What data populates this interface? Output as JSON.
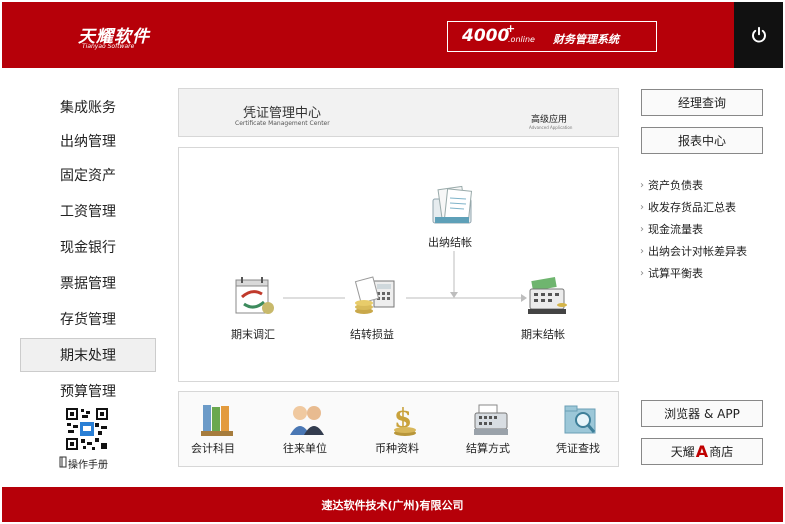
{
  "header": {
    "logo_main": "天耀软件",
    "logo_sub": "Tianyao Software",
    "system_number": "4000",
    "system_plus": "+",
    "system_online": ".online",
    "system_title": "财务管理系统",
    "power_icon": "power-icon"
  },
  "sidebar": {
    "items": [
      {
        "label": "集成账务"
      },
      {
        "label": "出纳管理"
      },
      {
        "label": "固定资产"
      },
      {
        "label": "工资管理"
      },
      {
        "label": "现金银行"
      },
      {
        "label": "票据管理"
      },
      {
        "label": "存货管理"
      },
      {
        "label": "期末处理",
        "active": true
      },
      {
        "label": "预算管理"
      }
    ],
    "qr_icon": "qr-code-icon",
    "manual_label": "操作手册"
  },
  "certificate": {
    "title": "凭证管理中心",
    "subtitle": "Certificate Management Center",
    "advanced": "高级应用",
    "advanced_sub": "Advanced Application"
  },
  "flow": {
    "cashier_close": "出纳结帐",
    "period_adjust": "期末调汇",
    "transfer_pl": "结转损益",
    "period_close": "期末结帐"
  },
  "toolbar": {
    "items": [
      {
        "label": "会计科目",
        "icon": "binders-icon"
      },
      {
        "label": "往来单位",
        "icon": "people-icon"
      },
      {
        "label": "币种资料",
        "icon": "dollar-coins-icon"
      },
      {
        "label": "结算方式",
        "icon": "cash-register-icon"
      },
      {
        "label": "凭证查找",
        "icon": "folder-search-icon"
      }
    ]
  },
  "right": {
    "buttons": [
      {
        "label": "经理查询"
      },
      {
        "label": "报表中心"
      }
    ],
    "links": [
      {
        "label": "资产负债表"
      },
      {
        "label": "收发存货品汇总表"
      },
      {
        "label": "现金流量表"
      },
      {
        "label": "出纳会计对帐差异表"
      },
      {
        "label": "试算平衡表"
      }
    ],
    "browser_app": "浏览器 & APP",
    "store_prefix": "天耀",
    "store_mark": "A",
    "store_suffix": "商店"
  },
  "footer": {
    "company": "速达软件技术(广州)有限公司"
  },
  "colors": {
    "brand_red": "#b60009",
    "power_bg": "#111111",
    "store_mark": "#c00000"
  }
}
